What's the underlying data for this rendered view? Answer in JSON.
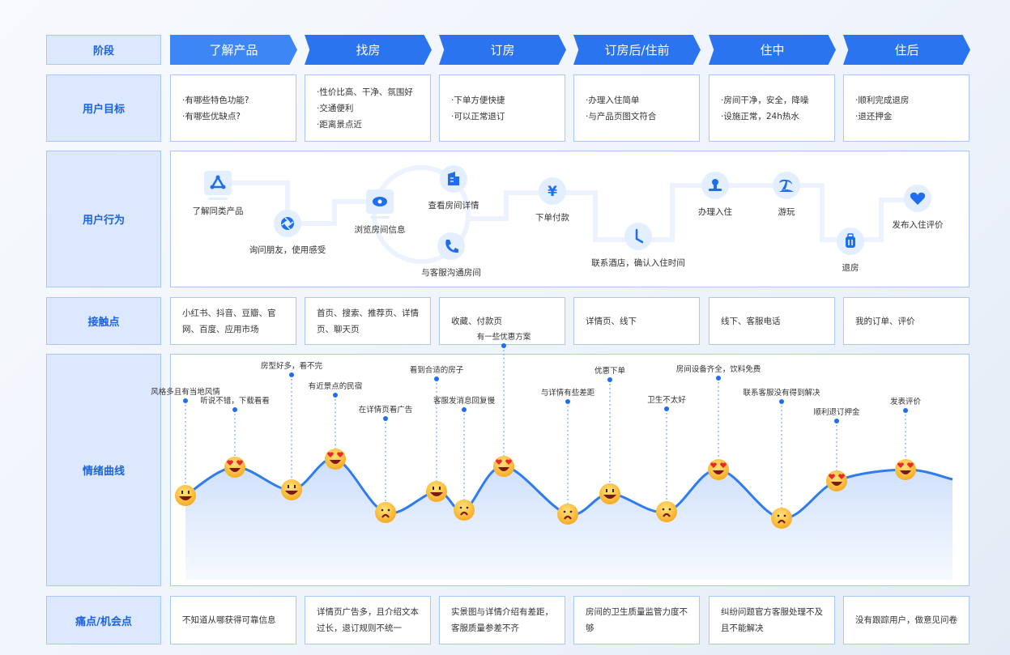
{
  "row_labels": {
    "stage": "阶段",
    "goals": "用户目标",
    "behavior": "用户行为",
    "touchpoints": "接触点",
    "emotion": "情绪曲线",
    "pain": "痛点/机会点"
  },
  "stages": [
    "了解产品",
    "找房",
    "订房",
    "订房后/住前",
    "住中",
    "住后"
  ],
  "goals": [
    [
      "·有哪些特色功能?",
      "·有哪些优缺点?"
    ],
    [
      "·性价比高、干净、氛围好",
      "·交通便利",
      "·距离景点近"
    ],
    [
      "·下单方便快捷",
      "·可以正常退订"
    ],
    [
      "·办理入住简单",
      "·与产品页图文符合"
    ],
    [
      "·房间干净，安全，降噪",
      "·设施正常，24h热水"
    ],
    [
      "·顺利完成退房",
      "·退还押金"
    ]
  ],
  "behaviors": [
    {
      "label": "了解同类产品",
      "icon": "triangle-nodes-icon"
    },
    {
      "label": "询问朋友，使用感受",
      "icon": "aperture-icon"
    },
    {
      "label": "浏览房间信息",
      "icon": "eye-icon"
    },
    {
      "label": "查看房间详情",
      "icon": "building-icon"
    },
    {
      "label": "与客服沟通房间",
      "icon": "phone-icon"
    },
    {
      "label": "下单付款",
      "icon": "yen-icon"
    },
    {
      "label": "联系酒店，确认入住时间",
      "icon": "clock-icon"
    },
    {
      "label": "办理入住",
      "icon": "stamp-icon"
    },
    {
      "label": "游玩",
      "icon": "palm-tree-icon"
    },
    {
      "label": "退房",
      "icon": "suitcase-icon"
    },
    {
      "label": "发布入住评价",
      "icon": "heart-icon"
    }
  ],
  "touchpoints": [
    "小红书、抖音、豆瓣、官网、百度、应用市场",
    "首页、搜索、推荐页、详情页、聊天页",
    "收藏、付款页",
    "详情页、线下",
    "线下、客服电话",
    "我的订单、评价"
  ],
  "chart_data": {
    "type": "line",
    "points": [
      {
        "label": "风格多且有当地风情",
        "mood": "smile",
        "level": 48
      },
      {
        "label": "听说不错，下载看看",
        "mood": "love",
        "level": 83
      },
      {
        "label": "房型好多，看不完",
        "mood": "smile",
        "level": 55
      },
      {
        "label": "有近景点的民宿",
        "mood": "love",
        "level": 93
      },
      {
        "label": "在详情页看广告",
        "mood": "sad",
        "level": 27
      },
      {
        "label": "看到合适的房子",
        "mood": "smile",
        "level": 53
      },
      {
        "label": "客服发消息回复慢",
        "mood": "sad",
        "level": 30
      },
      {
        "label": "有一些优惠方案",
        "mood": "love",
        "level": 84
      },
      {
        "label": "与详情有些差距",
        "mood": "sad",
        "level": 25
      },
      {
        "label": "优惠下单",
        "mood": "smile",
        "level": 50
      },
      {
        "label": "卫生不太好",
        "mood": "sad",
        "level": 28
      },
      {
        "label": "房间设备齐全，饮料免费",
        "mood": "love",
        "level": 80
      },
      {
        "label": "联系客服没有得到解决",
        "mood": "sad",
        "level": 20
      },
      {
        "label": "顺利退订押金",
        "mood": "love",
        "level": 66
      },
      {
        "label": "发表评价",
        "mood": "love",
        "level": 80
      }
    ]
  },
  "pain_points": [
    "不知道从哪获得可靠信息",
    "详情页广告多，且介绍文本过长，退订规则不统一",
    "实景图与详情介绍有差距，客服质量参差不齐",
    "房间的卫生质量监管力度不够",
    "纠纷问题官方客服处理不及且不能解决",
    "没有跟踪用户，做意见问卷"
  ],
  "colors": {
    "accent": "#2b74f0",
    "label_bg": "#dce8fd",
    "border": "#a9c8f8",
    "curve": "#2f7bf0"
  }
}
